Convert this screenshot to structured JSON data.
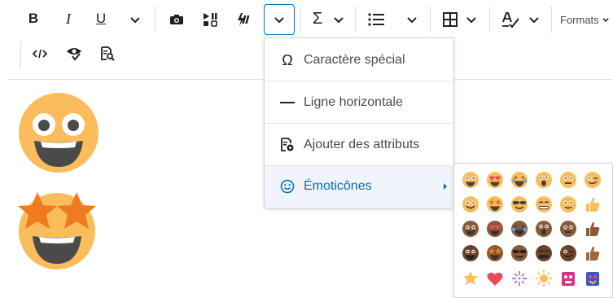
{
  "toolbar": {
    "buttons": [
      {
        "name": "bold-button",
        "glyph": "B"
      },
      {
        "name": "italic-button",
        "glyph": "I"
      },
      {
        "name": "underline-button",
        "glyph": "U"
      }
    ],
    "formats_label": "Formats"
  },
  "menu": {
    "items": [
      {
        "label": "Caractère spécial",
        "icon": "omega-icon"
      },
      {
        "label": "Ligne horizontale",
        "icon": "horizontal-line-icon"
      },
      {
        "label": "Ajouter des attributs",
        "icon": "attributes-icon"
      },
      {
        "label": "Émoticônes",
        "icon": "smiley-icon"
      }
    ]
  },
  "emoji_panel": {
    "rows": [
      [
        "grinning",
        "heart-eyes",
        "laughing",
        "surprised",
        "neutral",
        "winking"
      ],
      [
        "smiling",
        "star-eyes",
        "sunglasses",
        "grimacing",
        "grinning-sweat",
        "thumbs-up"
      ],
      [
        "grinning-dark",
        "heart-eyes-dark",
        "laughing-dark",
        "surprised-dark",
        "neutral-dark",
        "thumbs-up-dark"
      ],
      [
        "grinning-dark2",
        "star-eyes-dark",
        "sunglasses-dark",
        "grimacing-dark",
        "winking-dark",
        "thumbs-up-dark2"
      ],
      [
        "star",
        "heart",
        "sparkle",
        "sun",
        "monster-pink",
        "monster-blue"
      ]
    ]
  },
  "colors": {
    "accent": "#006fbf",
    "emoji_yellow": "#fbbd5c",
    "emoji_dark": "#8a5a36",
    "star_orange": "#f07a1f"
  }
}
